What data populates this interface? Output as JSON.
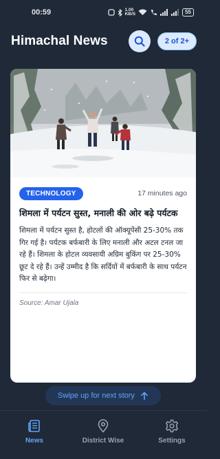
{
  "status_bar": {
    "time": "00:59",
    "network_speed_value": "1.00",
    "network_speed_unit": "KB/S",
    "battery": "55"
  },
  "header": {
    "title": "Himachal News",
    "counter": "2 of 2+"
  },
  "article": {
    "category": "TECHNOLOGY",
    "time_ago": "17 minutes ago",
    "headline": "शिमला में पर्यटन सुस्त, मनाली की ओर बढ़े पर्यटक",
    "summary": "शिमला में पर्यटन सुस्त है, होटलों की ऑक्यूपेंसी 25-30% तक गिर गई है। पर्यटक बर्फबारी के लिए मनाली और अटल टनल जा रहे हैं। शिमला के होटल व्यवसायी अग्रिम बुकिंग पर 25-30% छूट दे रहे हैं। उन्हें उम्मीद है कि सर्दियों में बर्फबारी के साथ पर्यटन फिर से बढ़ेगा।",
    "source": "Source: Amar Ujala"
  },
  "swipe_hint": "Swipe up for next story",
  "nav": {
    "items": [
      {
        "label": "News",
        "icon": "news-icon",
        "active": true
      },
      {
        "label": "District Wise",
        "icon": "location-pin-icon",
        "active": false
      },
      {
        "label": "Settings",
        "icon": "gear-icon",
        "active": false
      }
    ]
  },
  "colors": {
    "background": "#1f2937",
    "accent": "#2563eb",
    "active_nav": "#60a5fa"
  }
}
